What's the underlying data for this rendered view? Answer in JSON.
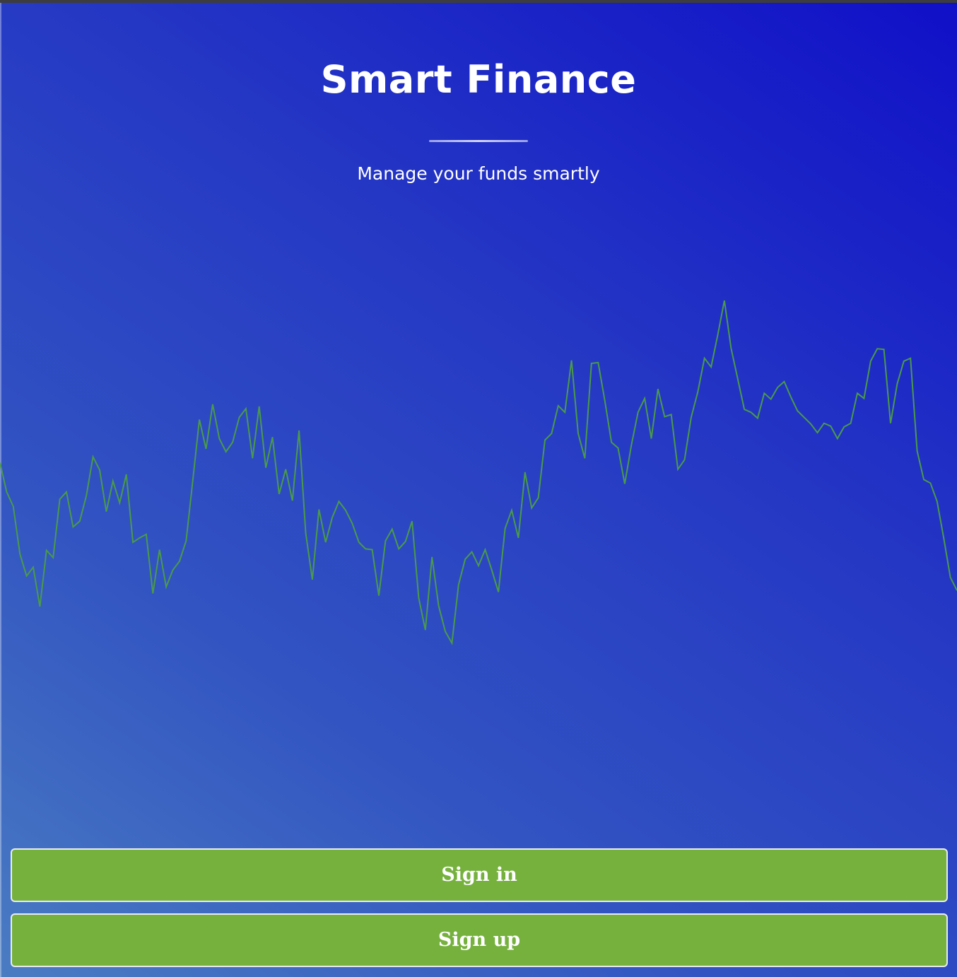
{
  "app": {
    "title": "Smart Finance",
    "subtitle": "Manage your funds smartly"
  },
  "actions": {
    "sign_in_label": "Sign in",
    "sign_up_label": "Sign up"
  },
  "colors": {
    "background_gradient_start": "#4a7cc2",
    "background_gradient_end": "#1010c8",
    "line": "#4a9a4a",
    "button": "#76b13e",
    "button_text": "#ffffff"
  },
  "chart_data": {
    "type": "line",
    "title": "",
    "xlabel": "",
    "ylabel": "",
    "grid": false,
    "legend": "none",
    "ylim": [
      0,
      600
    ],
    "y": [
      315,
      275,
      255,
      190,
      160,
      172,
      118,
      195,
      185,
      265,
      275,
      227,
      235,
      270,
      323,
      305,
      248,
      290,
      260,
      299,
      206,
      212,
      217,
      136,
      196,
      145,
      168,
      180,
      208,
      290,
      374,
      334,
      395,
      348,
      330,
      343,
      377,
      389,
      321,
      392,
      308,
      350,
      272,
      306,
      263,
      359,
      219,
      155,
      251,
      206,
      240,
      262,
      250,
      232,
      206,
      197,
      196,
      133,
      208,
      224,
      197,
      207,
      235,
      130,
      86,
      186,
      119,
      84,
      68,
      148,
      183,
      193,
      174,
      196,
      168,
      138,
      225,
      250,
      212,
      302,
      253,
      267,
      346,
      355,
      393,
      384,
      455,
      355,
      321,
      451,
      452,
      400,
      343,
      335,
      286,
      339,
      384,
      403,
      348,
      416,
      378,
      381,
      306,
      319,
      377,
      412,
      458,
      446,
      490,
      537,
      472,
      430,
      388,
      384,
      376,
      410,
      402,
      418,
      426,
      405,
      386,
      377,
      368,
      356,
      369,
      365,
      348,
      364,
      369,
      410,
      403,
      454,
      471,
      470,
      369,
      423,
      454,
      458,
      331,
      292,
      287,
      262,
      212,
      158,
      140
    ]
  }
}
